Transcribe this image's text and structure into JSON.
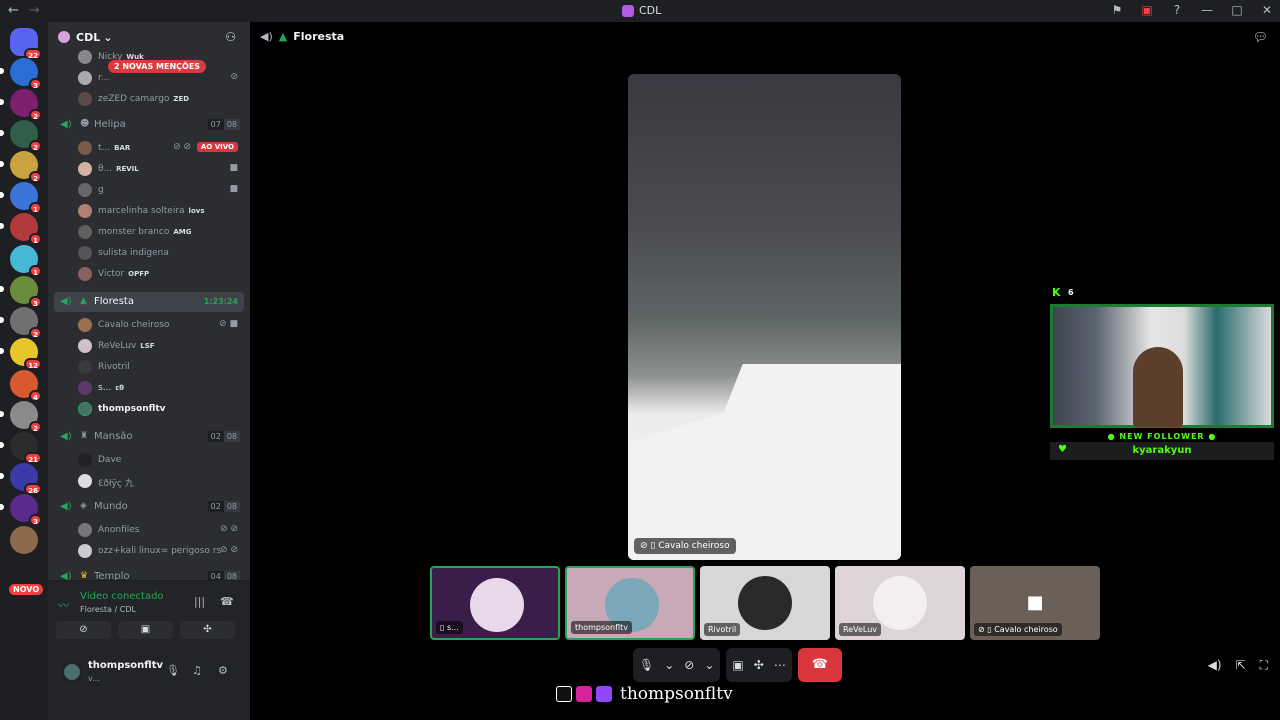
{
  "window": {
    "title": "CDL"
  },
  "guild_badges": [
    "22",
    "3",
    "2",
    "2",
    "2",
    "1",
    "1",
    "1",
    "3",
    "2",
    "12",
    "4",
    "2",
    "21",
    "26",
    "3"
  ],
  "novo_label": "NOVO",
  "server": {
    "name": "CDL",
    "new_mentions": "2 NOVAS MENÇÕES"
  },
  "members_top": [
    {
      "name": "Nicky",
      "tag": "Wuk"
    },
    {
      "name": "r..."
    },
    {
      "name": "zeZED camargo",
      "tag": "ZED"
    }
  ],
  "channels": [
    {
      "name": "Helipa",
      "count": [
        "07",
        "08"
      ],
      "members": [
        {
          "name": "t...",
          "tag": "BAR",
          "live": "AO VIVO"
        },
        {
          "name": "θ...",
          "tag": "REVIL"
        },
        {
          "name": "g"
        },
        {
          "name": "marcelinha solteira",
          "tag": "lovs"
        },
        {
          "name": "monster branco",
          "tag": "AMG"
        },
        {
          "name": "sulista indigena"
        },
        {
          "name": "Victor",
          "tag": "OPFP"
        }
      ]
    },
    {
      "name": "Floresta",
      "timer": "1:23:24",
      "members": [
        {
          "name": "Cavalo cheiroso"
        },
        {
          "name": "ReVeLuv",
          "tag": "LSF"
        },
        {
          "name": "Rivotril"
        },
        {
          "name": "s...",
          "tag": "εθ"
        },
        {
          "name": "thompsonfltv"
        }
      ]
    },
    {
      "name": "Mansão",
      "count": [
        "02",
        "08"
      ],
      "members": [
        {
          "name": "Dave"
        },
        {
          "name": "Ɛðłÿç 九"
        }
      ]
    },
    {
      "name": "Mundo",
      "count": [
        "02",
        "08"
      ],
      "members": [
        {
          "name": "Anonfiles"
        },
        {
          "name": "ozz+kali linux= perigoso rs"
        }
      ]
    },
    {
      "name": "Templo",
      "count": [
        "04",
        "08"
      ]
    }
  ],
  "voice_panel": {
    "status": "Vídeo conectado",
    "location": "Floresta / CDL"
  },
  "user": {
    "name": "thompsonfltv",
    "status": "v..."
  },
  "main": {
    "channel": "Floresta",
    "stage_label": "Cavalo cheiroso"
  },
  "overlay": {
    "count": "6",
    "title": "NEW FOLLOWER",
    "follower": "kyarakyun"
  },
  "tiles": [
    {
      "label": "s...",
      "speaking": true,
      "bg": "#3a1e4a"
    },
    {
      "label": "thompsonfltv",
      "speaking": true,
      "bg": "#c7a9b8"
    },
    {
      "label": "Rivotril",
      "speaking": false,
      "bg": "#d7d7d7"
    },
    {
      "label": "ReVeLuv",
      "speaking": false,
      "bg": "#ddd3d9"
    },
    {
      "label": "Cavalo cheiroso",
      "speaking": false,
      "bg": "#6b6058"
    }
  ],
  "brand": {
    "name": "thompsonfltv"
  }
}
